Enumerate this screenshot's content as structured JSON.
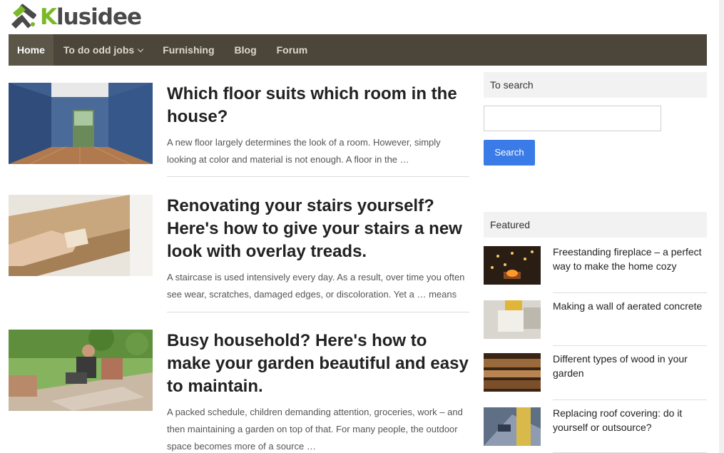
{
  "site": {
    "logo_first": "K",
    "logo_rest": "lusidee",
    "brand_color": "#7cb927"
  },
  "nav": {
    "items": [
      {
        "label": "Home",
        "active": true
      },
      {
        "label": "To do odd jobs",
        "dropdown": true
      },
      {
        "label": "Furnishing"
      },
      {
        "label": "Blog"
      },
      {
        "label": "Forum"
      }
    ],
    "bg_color": "#4b4639"
  },
  "articles": [
    {
      "title": "Which floor suits which room in the house?",
      "excerpt": "A new floor largely determines the look of a room. However, simply looking at color and material is not enough. A floor in the …"
    },
    {
      "title": "Renovating your stairs yourself? Here's how to give your stairs a new look with overlay treads.",
      "excerpt": "A staircase is used intensively every day. As a result, over time you often see wear, scratches, damaged edges, or discoloration. Yet a … means"
    },
    {
      "title": "Busy household? Here's how to make your garden beautiful and easy to maintain.",
      "excerpt": "A packed schedule, children demanding attention, groceries, work – and then maintaining a garden on top of that. For many people, the outdoor space becomes more of a source …"
    }
  ],
  "sidebar": {
    "search_heading": "To search",
    "search_value": "",
    "search_button": "Search",
    "featured_heading": "Featured",
    "featured": [
      {
        "title": "Freestanding fireplace – a perfect way to make the home cozy"
      },
      {
        "title": "Making a wall of aerated concrete"
      },
      {
        "title": "Different types of wood in your garden"
      },
      {
        "title": "Replacing roof covering: do it yourself or outsource?"
      }
    ],
    "accent_color": "#3b7be8"
  }
}
